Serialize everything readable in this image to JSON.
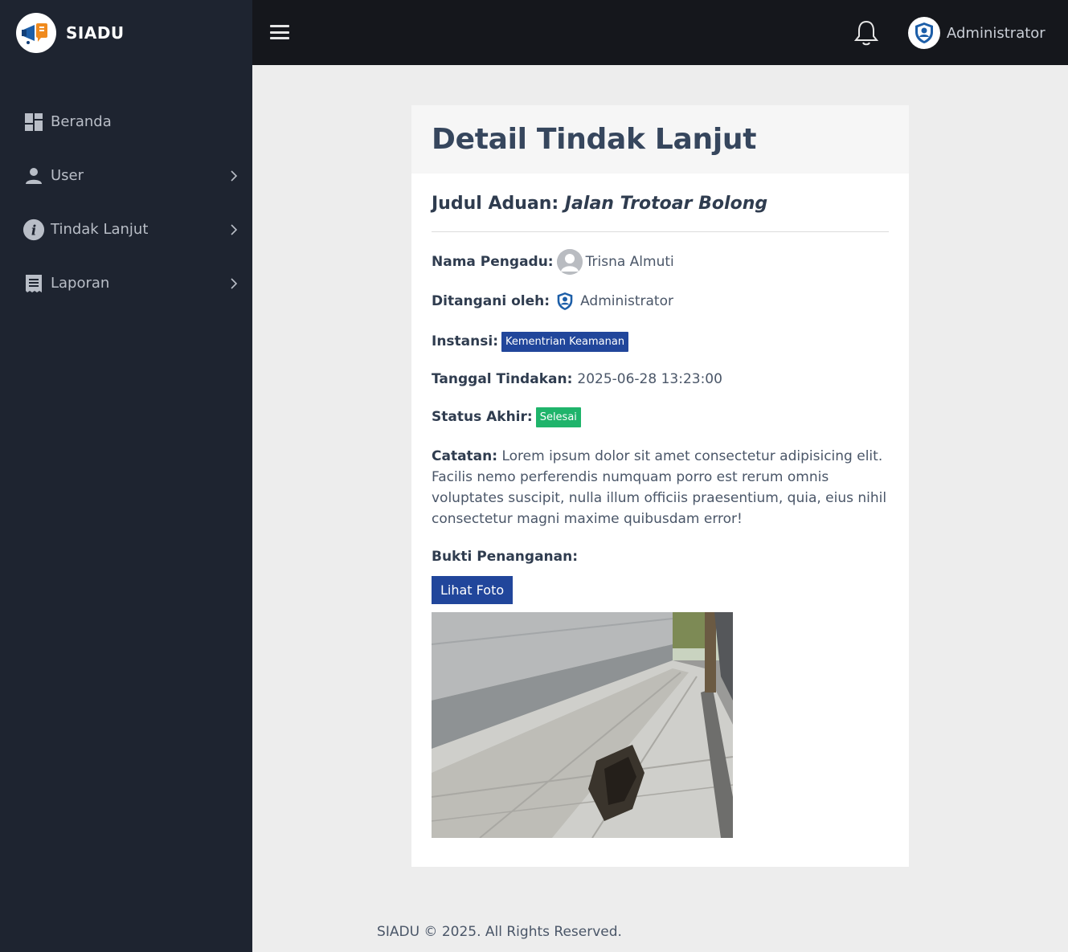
{
  "brand": {
    "name": "SIADU"
  },
  "sidebar": {
    "items": [
      {
        "label": "Beranda",
        "icon": "dashboard-icon",
        "has_submenu": false
      },
      {
        "label": "User",
        "icon": "user-icon",
        "has_submenu": true
      },
      {
        "label": "Tindak Lanjut",
        "icon": "info-icon",
        "has_submenu": true
      },
      {
        "label": "Laporan",
        "icon": "receipt-icon",
        "has_submenu": true
      }
    ]
  },
  "topbar": {
    "menu_icon": "hamburger-icon",
    "notification_icon": "bell-icon",
    "user_name": "Administrator"
  },
  "detail": {
    "page_title": "Detail Tindak Lanjut",
    "judul_label": "Judul Aduan:",
    "judul_value": "Jalan Trotoar Bolong",
    "pengadu_label": "Nama Pengadu:",
    "pengadu_value": "Trisna Almuti",
    "ditangani_label": "Ditangani oleh:",
    "ditangani_value": "Administrator",
    "instansi_label": "Instansi:",
    "instansi_value": "Kementrian Keamanan",
    "tanggal_label": "Tanggal Tindakan:",
    "tanggal_value": "2025-06-28 13:23:00",
    "status_label": "Status Akhir:",
    "status_value": "Selesai",
    "catatan_label": "Catatan:",
    "catatan_value": "Lorem ipsum dolor sit amet consectetur adipisicing elit. Facilis nemo perferendis numquam porro est rerum omnis voluptates suscipit, nulla illum officiis praesentium, quia, eius nihil consectetur magni maxime quibusdam error!",
    "bukti_label": "Bukti Penanganan:",
    "lihat_foto_label": "Lihat Foto"
  },
  "colors": {
    "sidebar_bg": "#1e2430",
    "topbar_bg": "#15171c",
    "primary": "#21469b",
    "success": "#1fb46b"
  },
  "footer": {
    "text": "SIADU © 2025. All Rights Reserved."
  }
}
